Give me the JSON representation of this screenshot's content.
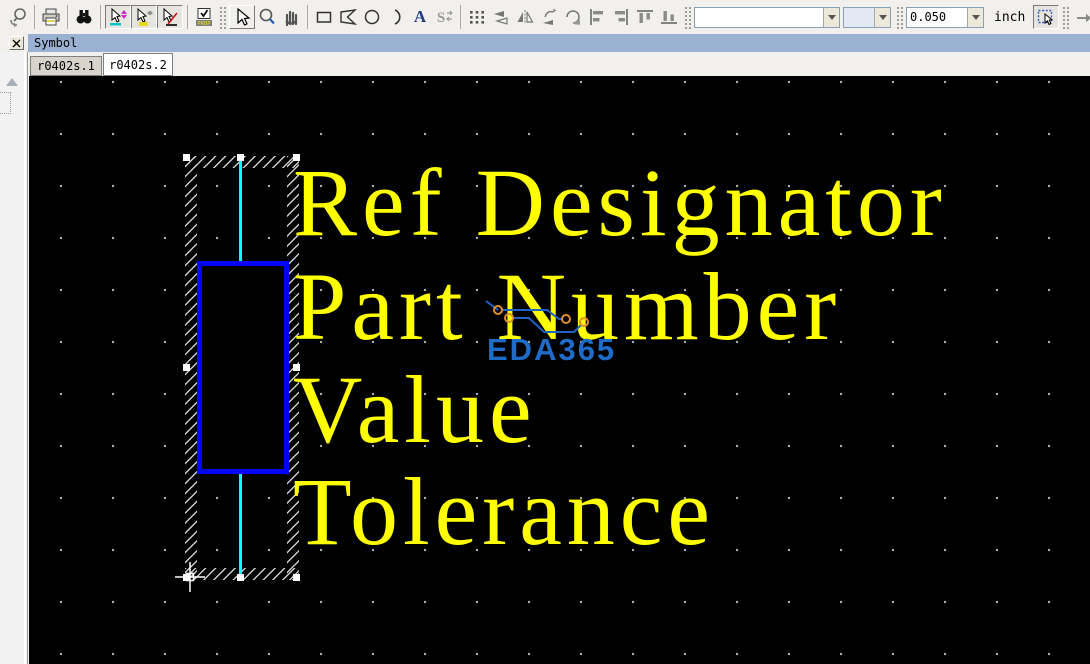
{
  "toolbar": {
    "scale_combo": {
      "value": "0.050"
    },
    "unit_label": "inch",
    "empty_combo_1": "",
    "empty_combo_2": "",
    "text_tool_label": "A",
    "shape_tool_label": "S",
    "abc_label": "ABC",
    "icons": [
      "zoom-redisplay-icon",
      "print-icon",
      "find-icon",
      "snap-move-icon",
      "snap-mirror-icon",
      "snap-rotate-icon",
      "prop-edit-icon",
      "pointer-icon",
      "zoom-in-icon",
      "pan-icon",
      "rect-icon",
      "polygon-icon",
      "circle-icon",
      "arc-icon",
      "text-icon",
      "shape-select-icon",
      "grid-icon",
      "flip-icon",
      "mirror-icon",
      "spin-icon",
      "rotate-icon",
      "align-left-icon",
      "align-right-icon",
      "align-top-icon",
      "align-bottom-icon",
      "select-rect-icon",
      "next-icon",
      "abc-next-icon",
      "step-icon"
    ]
  },
  "symbol_panel": {
    "title": "Symbol",
    "close_glyph": "✕"
  },
  "tabs": [
    {
      "label": "r0402s.1",
      "active": false
    },
    {
      "label": "r0402s.2",
      "active": true
    }
  ],
  "canvas": {
    "labels": [
      "Ref Designator",
      "Part Number",
      "Value",
      "Tolerance"
    ],
    "watermark_text": "EDA365",
    "colors": {
      "label_text": "#FFFF00",
      "pin_line": "#00FFFF",
      "body_rect": "#0000FF",
      "watermark": "#1E6BC8",
      "background": "#000000"
    }
  }
}
